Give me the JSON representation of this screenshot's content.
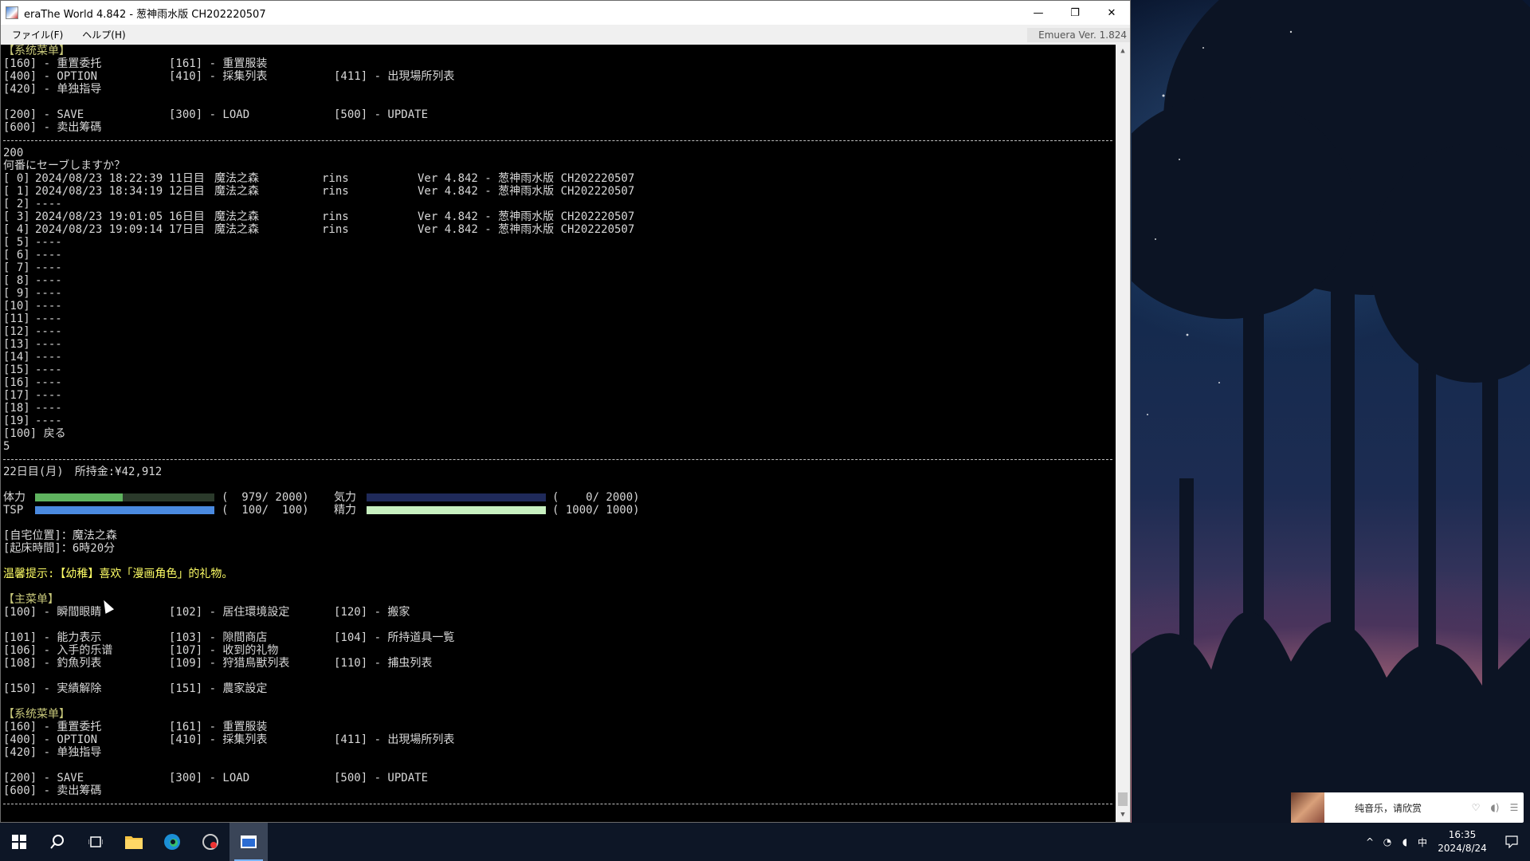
{
  "window": {
    "title": "eraThe World 4.842 - 葱神雨水版 CH202220507",
    "minimize": "—",
    "restore": "❐",
    "close": "✕"
  },
  "menubar": {
    "file": "ファイル(F)",
    "help": "ヘルプ(H)",
    "engine_version": "Emuera Ver. 1.824"
  },
  "console": {
    "top_system_menu": {
      "header": "【系统菜单】",
      "rows": [
        [
          "[160] - 重置委托",
          "[161] - 重置服装",
          ""
        ],
        [
          "[400] - OPTION",
          "[410] - 採集列表",
          "[411] - 出現場所列表"
        ],
        [
          "[420] - 单独指导",
          "",
          ""
        ],
        [
          "",
          "",
          ""
        ],
        [
          "[200] - SAVE",
          "[300] - LOAD",
          "[500] - UPDATE"
        ],
        [
          "[600] - 卖出筹碼",
          "",
          ""
        ]
      ]
    },
    "save_input": "200",
    "save_prompt": "何番にセーブしますか？",
    "save_slots": [
      {
        "slot": "[ 0]",
        "datetime": "2024/08/23 18:22:39",
        "day": "11日目",
        "place": "魔法之森",
        "user": "rins",
        "ver": "Ver 4.842 - 葱神雨水版 CH202220507"
      },
      {
        "slot": "[ 1]",
        "datetime": "2024/08/23 18:34:19",
        "day": "12日目",
        "place": "魔法之森",
        "user": "rins",
        "ver": "Ver 4.842 - 葱神雨水版 CH202220507"
      },
      {
        "slot": "[ 2]",
        "datetime": "----",
        "day": "",
        "place": "",
        "user": "",
        "ver": ""
      },
      {
        "slot": "[ 3]",
        "datetime": "2024/08/23 19:01:05",
        "day": "16日目",
        "place": "魔法之森",
        "user": "rins",
        "ver": "Ver 4.842 - 葱神雨水版 CH202220507"
      },
      {
        "slot": "[ 4]",
        "datetime": "2024/08/23 19:09:14",
        "day": "17日目",
        "place": "魔法之森",
        "user": "rins",
        "ver": "Ver 4.842 - 葱神雨水版 CH202220507"
      },
      {
        "slot": "[ 5]",
        "datetime": "----",
        "day": "",
        "place": "",
        "user": "",
        "ver": ""
      },
      {
        "slot": "[ 6]",
        "datetime": "----",
        "day": "",
        "place": "",
        "user": "",
        "ver": ""
      },
      {
        "slot": "[ 7]",
        "datetime": "----",
        "day": "",
        "place": "",
        "user": "",
        "ver": ""
      },
      {
        "slot": "[ 8]",
        "datetime": "----",
        "day": "",
        "place": "",
        "user": "",
        "ver": ""
      },
      {
        "slot": "[ 9]",
        "datetime": "----",
        "day": "",
        "place": "",
        "user": "",
        "ver": ""
      },
      {
        "slot": "[10]",
        "datetime": "----",
        "day": "",
        "place": "",
        "user": "",
        "ver": ""
      },
      {
        "slot": "[11]",
        "datetime": "----",
        "day": "",
        "place": "",
        "user": "",
        "ver": ""
      },
      {
        "slot": "[12]",
        "datetime": "----",
        "day": "",
        "place": "",
        "user": "",
        "ver": ""
      },
      {
        "slot": "[13]",
        "datetime": "----",
        "day": "",
        "place": "",
        "user": "",
        "ver": ""
      },
      {
        "slot": "[14]",
        "datetime": "----",
        "day": "",
        "place": "",
        "user": "",
        "ver": ""
      },
      {
        "slot": "[15]",
        "datetime": "----",
        "day": "",
        "place": "",
        "user": "",
        "ver": ""
      },
      {
        "slot": "[16]",
        "datetime": "----",
        "day": "",
        "place": "",
        "user": "",
        "ver": ""
      },
      {
        "slot": "[17]",
        "datetime": "----",
        "day": "",
        "place": "",
        "user": "",
        "ver": ""
      },
      {
        "slot": "[18]",
        "datetime": "----",
        "day": "",
        "place": "",
        "user": "",
        "ver": ""
      },
      {
        "slot": "[19]",
        "datetime": "----",
        "day": "",
        "place": "",
        "user": "",
        "ver": ""
      }
    ],
    "back_option": "[100] 戻る",
    "back_input": "5",
    "status_line": "22日目(月)　所持金:¥42,912",
    "stats": [
      {
        "label": "体力",
        "value_text": "(  979/ 2000)",
        "fraction": 0.4895,
        "color": "#5fb35f",
        "label2": "気力",
        "value_text2": "(    0/ 2000)",
        "fraction2": 0.0,
        "color2": "#2a3f8f",
        "track2": "#1f2a5a"
      },
      {
        "label": "TSP",
        "value_text": "(  100/  100)",
        "fraction": 1.0,
        "color": "#4a8ae0",
        "label2": "精力",
        "value_text2": "( 1000/ 1000)",
        "fraction2": 1.0,
        "color2": "#c8f0c0",
        "track2": "#1f2a5a"
      }
    ],
    "home_location": "[自宅位置]：魔法之森",
    "wake_time": "[起床時間]：6時20分",
    "hint": "温馨提示:【幼稚】喜欢「漫画角色」的礼物。",
    "main_menu": {
      "header": "【主菜单】",
      "rows": [
        [
          "[100] - 瞬間眼睛",
          "[102] - 居住環境設定",
          "[120] - 搬家"
        ],
        [
          "",
          "",
          ""
        ],
        [
          "[101] - 能力表示",
          "[103] - 隙間商店",
          "[104] - 所持道具一覧"
        ],
        [
          "[106] - 入手的乐谱",
          "[107] - 收到的礼物",
          ""
        ],
        [
          "[108] - 釣魚列表",
          "[109] - 狩猎鳥獣列表",
          "[110] - 捕虫列表"
        ],
        [
          "",
          "",
          ""
        ],
        [
          "[150] - 実績解除",
          "[151] - 農家設定",
          ""
        ]
      ]
    },
    "bottom_system_menu": {
      "header": "【系统菜单】",
      "rows": [
        [
          "[160] - 重置委托",
          "[161] - 重置服装",
          ""
        ],
        [
          "[400] - OPTION",
          "[410] - 採集列表",
          "[411] - 出現場所列表"
        ],
        [
          "[420] - 单独指导",
          "",
          ""
        ],
        [
          "",
          "",
          ""
        ],
        [
          "[200] - SAVE",
          "[300] - LOAD",
          "[500] - UPDATE"
        ],
        [
          "[600] - 卖出筹碼",
          "",
          ""
        ]
      ]
    }
  },
  "taskbar": {
    "start_icon": "windows-logo",
    "search_icon": "search",
    "taskview_icon": "task-view",
    "explorer_icon": "folder",
    "edge_icon": "edge",
    "app_icon": "era-app",
    "active_icon": "emuera-window",
    "tray_chevron": "^",
    "ime": "中",
    "time": "16:35",
    "date": "2024/8/24"
  },
  "music_popup": {
    "text": "纯音乐，请欣赏"
  },
  "colors": {
    "console_bg": "#000000",
    "console_text": "#d8d8d8",
    "hint": "#ffff66",
    "header": "#c8c87a"
  }
}
